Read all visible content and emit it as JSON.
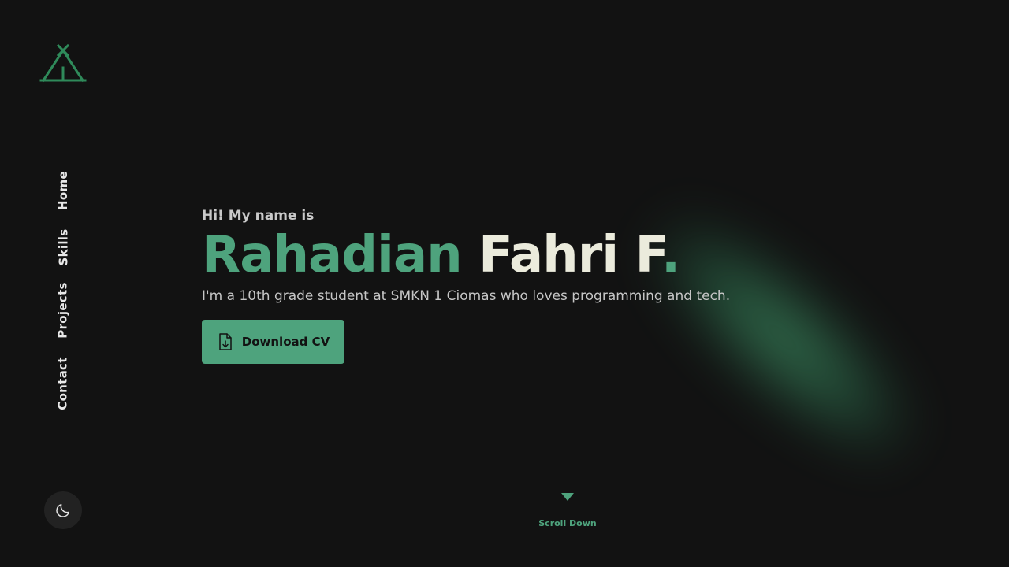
{
  "logo": {
    "icon": "tent-logo-icon",
    "color": "#2f8a5a"
  },
  "nav": {
    "items": [
      {
        "label": "Home"
      },
      {
        "label": "Skills"
      },
      {
        "label": "Projects"
      },
      {
        "label": "Contact"
      }
    ]
  },
  "theme_toggle": {
    "icon": "moon-icon"
  },
  "hero": {
    "greeting": "Hi! My name is",
    "first_name": "Rahadian",
    "last_name": "Fahri F",
    "name_dot": ".",
    "tagline": "I'm a 10th grade student at SMKN 1 Ciomas who loves programming and tech.",
    "cv_button_label": "Download CV",
    "cv_button_icon": "file-download-icon"
  },
  "scroll": {
    "label": "Scroll Down",
    "icon": "triangle-down-icon"
  },
  "colors": {
    "accent": "#4ea37d",
    "background": "#121212",
    "name_light": "#ebebdc"
  }
}
